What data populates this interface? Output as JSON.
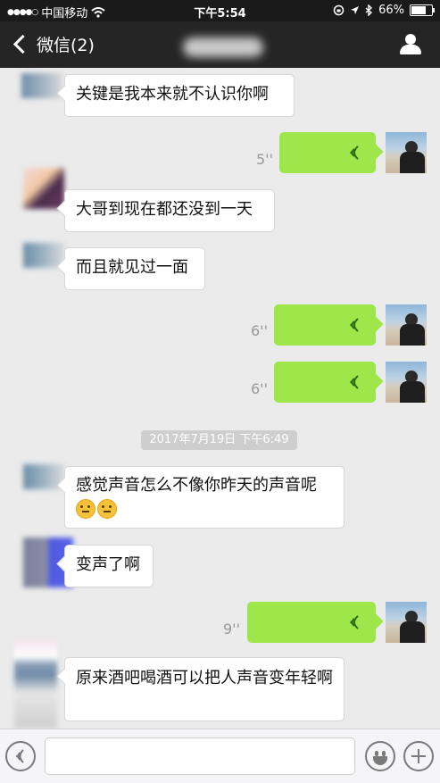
{
  "status_bar": {
    "carrier": "中国移动",
    "time": "下午5:54",
    "battery": "66%",
    "battery_level": 0.66
  },
  "nav": {
    "back_label": "微信(2)"
  },
  "timestamp": "2017年7月19日 下午6:49",
  "messages": [
    {
      "type": "text",
      "side": "left",
      "text": "关键是我本来就不认识你啊"
    },
    {
      "type": "voice",
      "side": "right",
      "duration": "5''"
    },
    {
      "type": "text",
      "side": "left",
      "text": "大哥到现在都还没到一天"
    },
    {
      "type": "text",
      "side": "left",
      "text": "而且就见过一面"
    },
    {
      "type": "voice",
      "side": "right",
      "duration": "6''"
    },
    {
      "type": "voice",
      "side": "right",
      "duration": "6''"
    },
    {
      "type": "text",
      "side": "left",
      "text": "感觉声音怎么不像你昨天的声音呢"
    },
    {
      "type": "text",
      "side": "left",
      "text": "变声了啊"
    },
    {
      "type": "voice",
      "side": "right",
      "duration": "9''"
    },
    {
      "type": "text",
      "side": "left",
      "text": "原来酒吧喝酒可以把人声音变年轻啊"
    }
  ],
  "input": {
    "placeholder": ""
  },
  "colors": {
    "voice_bubble": "#9ee64a",
    "nav_bg": "#252525",
    "chat_bg": "#ebebeb"
  },
  "icons": [
    "wifi-icon",
    "location-arrow-icon",
    "bluetooth-icon",
    "battery-icon",
    "back-chevron-icon",
    "profile-icon",
    "voice-wave-icon",
    "voice-toggle-icon",
    "emoji-icon",
    "plus-icon"
  ]
}
